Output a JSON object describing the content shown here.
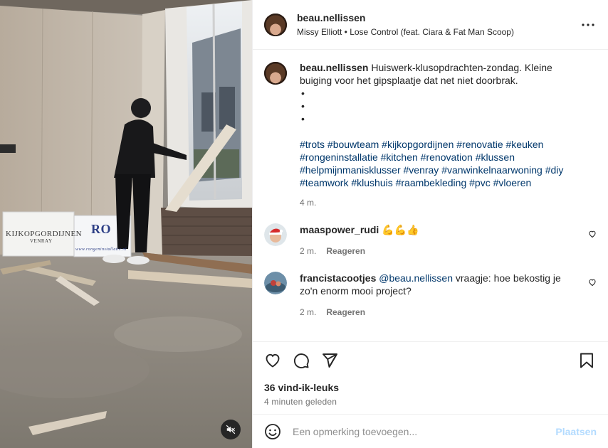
{
  "post": {
    "username": "beau.nellissen",
    "song": "Missy Elliott • Lose Control (feat. Ciara & Fat Man Scoop)",
    "caption": "Huiswerk-klusopdrachten-zondag. Kleine buiging voor het gipsplaatje dat net niet doorbrak.",
    "bullets": [
      "•",
      "•",
      "•"
    ],
    "hashtags": "#trots #bouwteam #kijkopgordijnen #renovatie #keuken #rongeninstallatie #kitchen #renovation #klussen #helpmijnmanisklusser #venray #vanwinkelnaarwoning #diy #teamwork #klushuis #raambekleding #pvc #vloeren",
    "age": "4 m.",
    "media_signs": {
      "sign1_main": "KIJKOPGORDIJNEN",
      "sign1_sub": "VENRAY",
      "sign2_main": "RO",
      "sign2_sub": "www.rongeninstallatie.nl"
    }
  },
  "comments": [
    {
      "username": "maaspower_rudi",
      "text": "💪💪👍",
      "age": "2 m.",
      "reply": "Reageren"
    },
    {
      "username": "francistacootjes",
      "mention": "@beau.nellissen",
      "text": "vraagje: hoe bekostig je zo'n enorm mooi project?",
      "age": "2 m.",
      "reply": "Reageren"
    }
  ],
  "stats": {
    "likes": "36 vind-ik-leuks",
    "time": "4 minuten geleden"
  },
  "comment_box": {
    "placeholder": "Een opmerking toevoegen...",
    "post_label": "Plaatsen"
  },
  "icons": {
    "more": "more-options-icon",
    "like": "heart-icon",
    "comment": "comment-icon",
    "share": "share-icon",
    "save": "bookmark-icon",
    "emoji": "emoji-icon",
    "mute": "speaker-muted-icon"
  },
  "colors": {
    "link": "#00376b",
    "muted": "#737373",
    "post_disabled": "#b3dbff"
  }
}
